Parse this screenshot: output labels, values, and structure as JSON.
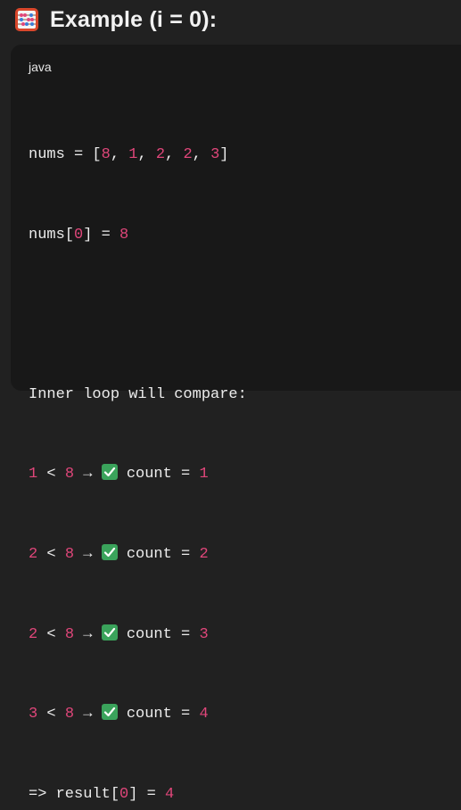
{
  "heading": {
    "icon": "abacus-icon",
    "text": "Example (i = 0):"
  },
  "code_block": {
    "language": "java",
    "line1": {
      "nums": "nums",
      "eq": " = [",
      "v1": "8",
      "c1": ", ",
      "v2": "1",
      "c2": ", ",
      "v3": "2",
      "c3": ", ",
      "v4": "2",
      "c4": ", ",
      "v5": "3",
      "end": "]"
    },
    "line2": {
      "pre": "nums[",
      "idx": "0",
      "mid": "] = ",
      "val": "8"
    },
    "line3": {
      "text": "Inner loop will compare:"
    },
    "compare_rows": [
      {
        "a": "1",
        "op": " < ",
        "b": "8",
        "arrow": " → ",
        "label": " count = ",
        "count": "1"
      },
      {
        "a": "2",
        "op": " < ",
        "b": "8",
        "arrow": " → ",
        "label": " count = ",
        "count": "2"
      },
      {
        "a": "2",
        "op": " < ",
        "b": "8",
        "arrow": " → ",
        "label": " count = ",
        "count": "3"
      },
      {
        "a": "3",
        "op": " < ",
        "b": "8",
        "arrow": " → ",
        "label": " count = ",
        "count": "4"
      }
    ],
    "result_line": {
      "pre": "=> result[",
      "idx": "0",
      "mid": "] = ",
      "val": "4"
    },
    "check_icon": "check-mark-button-icon",
    "colors": {
      "number": "#e0467a",
      "check_bg": "#3aa35b"
    }
  }
}
